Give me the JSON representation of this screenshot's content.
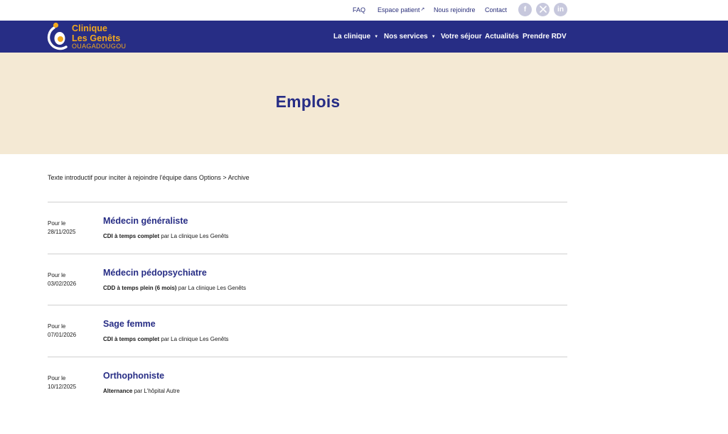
{
  "topbar": {
    "links": [
      "FAQ",
      "Espace patient",
      "Nous rejoindre",
      "Contact"
    ],
    "external_marker": "↗",
    "social": [
      {
        "icon": "facebook-icon",
        "glyph": "f"
      },
      {
        "icon": "x-twitter-icon",
        "glyph": "𝕏"
      },
      {
        "icon": "linkedin-icon",
        "glyph": "in"
      }
    ]
  },
  "brand": {
    "line1": "Clinique",
    "line2": "Les Genêts",
    "line3": "OUAGADOUGOU"
  },
  "nav": {
    "items": [
      {
        "label": "La clinique",
        "dropdown": "▼"
      },
      {
        "label": "Nos services",
        "dropdown": "▼"
      },
      {
        "label": "Votre séjour",
        "dropdown": ""
      },
      {
        "label": "Actualités",
        "dropdown": ""
      },
      {
        "label": "Prendre RDV",
        "dropdown": ""
      }
    ]
  },
  "hero": {
    "title": "Emplois"
  },
  "intro": "Texte introductif pour inciter à rejoindre l'équipe dans Options > Archive",
  "jobs": [
    {
      "date_prefix": "Pour le",
      "date": "28/11/2025",
      "title": "Médecin généraliste",
      "contract": "CDI à temps complet",
      "by": " par La clinique Les Genêts"
    },
    {
      "date_prefix": "Pour le",
      "date": "03/02/2026",
      "title": "Médecin pédopsychiatre",
      "contract": "CDD à temps plein (6 mois)",
      "by": " par La clinique Les Genêts"
    },
    {
      "date_prefix": "Pour le",
      "date": "07/01/2026",
      "title": "Sage femme",
      "contract": "CDI à temps complet",
      "by": " par La clinique Les Genêts"
    },
    {
      "date_prefix": "Pour le",
      "date": "10/12/2025",
      "title": "Orthophoniste",
      "contract": "Alternance",
      "by": " par L'hôpital Autre"
    }
  ],
  "colors": {
    "brand_navy": "#272d85",
    "brand_orange": "#f2a91e",
    "hero_bg": "#f4e9d4",
    "social_bg": "#c7c8dd"
  }
}
